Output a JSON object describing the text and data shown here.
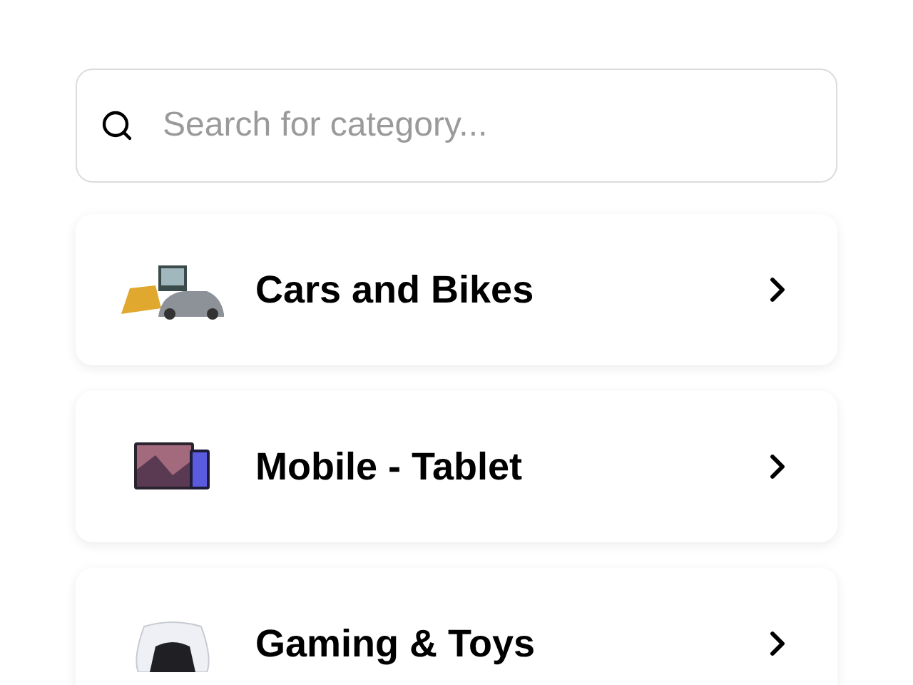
{
  "search": {
    "placeholder": "Search for category..."
  },
  "categories": [
    {
      "label": "Cars and Bikes",
      "kind": "vehicles"
    },
    {
      "label": "Mobile - Tablet",
      "kind": "devices"
    },
    {
      "label": "Gaming & Toys",
      "kind": "gaming"
    }
  ]
}
